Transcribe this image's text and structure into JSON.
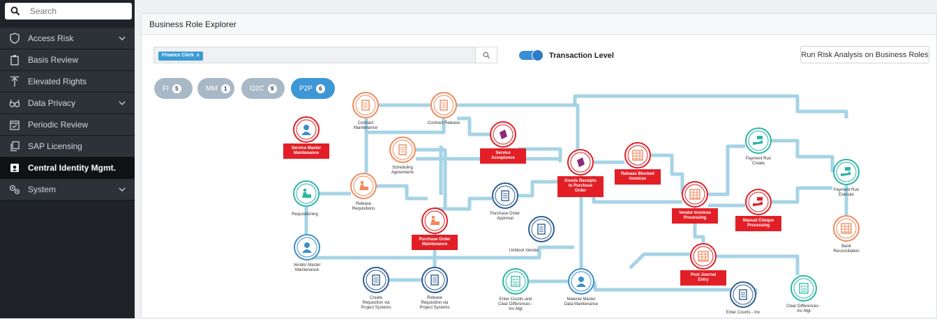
{
  "sidebar": {
    "search_placeholder": "Search",
    "items": [
      {
        "label": "Access Risk",
        "icon": "shield-icon",
        "has_chevron": true
      },
      {
        "label": "Basis Review",
        "icon": "clipboard-icon",
        "has_chevron": false
      },
      {
        "label": "Elevated Rights",
        "icon": "arrow-up-icon",
        "has_chevron": false
      },
      {
        "label": "Data Privacy",
        "icon": "glasses-icon",
        "has_chevron": true
      },
      {
        "label": "Periodic Review",
        "icon": "calendar-check-icon",
        "has_chevron": false
      },
      {
        "label": "SAP Licensing",
        "icon": "copy-icon",
        "has_chevron": false
      },
      {
        "label": "Central Identity Mgmt.",
        "icon": "id-card-icon",
        "has_chevron": false,
        "active": true
      },
      {
        "label": "System",
        "icon": "gears-icon",
        "has_chevron": true
      }
    ]
  },
  "main": {
    "title": "Business Role Explorer",
    "filter_chip": "Finance Clerk",
    "filter_chip_close": "x",
    "toggle_label": "Transaction Level",
    "toggle_on": true,
    "risk_button": "Run Risk Analysis on Business Roles",
    "pills": [
      {
        "label": "FI",
        "count": "5",
        "active": false
      },
      {
        "label": "MM",
        "count": "1",
        "active": false
      },
      {
        "label": "O2C",
        "count": "9",
        "active": false
      },
      {
        "label": "P2P",
        "count": "6",
        "active": true
      }
    ]
  },
  "diagram": {
    "colors": {
      "red": "#e21f26",
      "orange": "#f08a5d",
      "teal": "#2bb5a6",
      "blue": "#2f5d8f",
      "lightblue": "#3d8ec9",
      "line": "#a6d3e6"
    },
    "nodes": [
      {
        "id": "contract-maintenance",
        "label": "Contract\nMaintenance",
        "icon": "document-icon",
        "color": "orange",
        "highlight": false
      },
      {
        "id": "contract-release",
        "label": "Contract Release",
        "icon": "document-icon",
        "color": "orange",
        "highlight": false
      },
      {
        "id": "service-master-maintenance",
        "label": "Service Master\nMaintenance",
        "icon": "user-icon",
        "color": "lightblue",
        "highlight": true
      },
      {
        "id": "service-acceptance",
        "label": "Service\nAcceptance",
        "icon": "box-icon",
        "color": "purple",
        "highlight": true
      },
      {
        "id": "scheduling-agreements",
        "label": "Scheduling\nAgreements",
        "icon": "document-icon",
        "color": "orange",
        "highlight": false
      },
      {
        "id": "goods-receipts",
        "label": "Goods Receipts\nto Purchase\nOrder",
        "icon": "box-icon",
        "color": "purple",
        "highlight": true
      },
      {
        "id": "release-blocked-invoices",
        "label": "Release Blocked\nInvoices",
        "icon": "calculator-icon",
        "color": "orange",
        "highlight": true
      },
      {
        "id": "payment-run-create",
        "label": "Payment Run\nCreate",
        "icon": "hand-money-icon",
        "color": "teal",
        "highlight": false
      },
      {
        "id": "payment-run-execute",
        "label": "Payment Run\nExecute",
        "icon": "hand-money-icon",
        "color": "teal",
        "highlight": false
      },
      {
        "id": "requisitioning",
        "label": "Requisitioning",
        "icon": "person-box-icon",
        "color": "teal",
        "highlight": false
      },
      {
        "id": "release-requisitions",
        "label": "Release\nRequisitions",
        "icon": "person-box-icon",
        "color": "orange",
        "highlight": false
      },
      {
        "id": "purchase-order-approval",
        "label": "Purchase Order\nApproval",
        "icon": "document-icon",
        "color": "blue",
        "highlight": false
      },
      {
        "id": "vendor-invoices-processing",
        "label": "Vendor Invoices\nProcessing",
        "icon": "calculator-icon",
        "color": "orange",
        "highlight": true
      },
      {
        "id": "manual-cheque-processing",
        "label": "Manual Cheque\nProcessing",
        "icon": "hand-money-icon",
        "color": "red",
        "highlight": true
      },
      {
        "id": "bank-reconciliation",
        "label": "Bank\nReconciliation",
        "icon": "calculator-icon",
        "color": "orange",
        "highlight": false
      },
      {
        "id": "purchase-order-maintenance",
        "label": "Purchase Order\nMaintenance",
        "icon": "person-box-icon",
        "color": "orange",
        "highlight": true
      },
      {
        "id": "unblock-vendor",
        "label": "Unblock Vendor",
        "icon": "document-icon",
        "color": "blue",
        "highlight": false
      },
      {
        "id": "vendor-master-maintenance",
        "label": "Vendor Master\nMaintenance",
        "icon": "user-icon",
        "color": "lightblue",
        "highlight": false
      },
      {
        "id": "post-journal-entry",
        "label": "Post Journal\nEntry",
        "icon": "calculator-icon",
        "color": "orange",
        "highlight": true
      },
      {
        "id": "create-requisition-ps",
        "label": "Create\nRequisition via\nProject Systems",
        "icon": "document-icon",
        "color": "blue",
        "highlight": false
      },
      {
        "id": "release-requisition-ps",
        "label": "Release\nRequisition via\nProject Systems",
        "icon": "document-icon",
        "color": "blue",
        "highlight": false
      },
      {
        "id": "enter-counts-clear",
        "label": "Enter Counts and\nClear Differences -\nInv Mgt",
        "icon": "checklist-icon",
        "color": "teal",
        "highlight": false
      },
      {
        "id": "material-master",
        "label": "Material Master\nData Maintenance",
        "icon": "user-icon",
        "color": "lightblue",
        "highlight": false
      },
      {
        "id": "enter-counts-inv",
        "label": "Enter Counts - Inv",
        "icon": "document-icon",
        "color": "blue",
        "highlight": false
      },
      {
        "id": "clear-differences",
        "label": "Clear Differences -\nInv Mgt",
        "icon": "checklist-icon",
        "color": "teal",
        "highlight": false
      }
    ]
  }
}
